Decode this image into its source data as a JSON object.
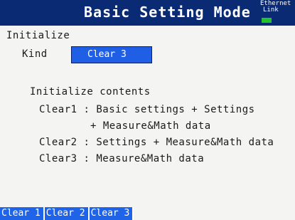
{
  "header": {
    "title": "Basic Setting Mode",
    "ethernet_line1": "Ethernet",
    "ethernet_line2": "Link",
    "link_led_color": "#22c22a",
    "background_color": "#0b2a74"
  },
  "section": {
    "heading": "Initialize",
    "kind_label": "Kind",
    "kind_value": "Clear 3"
  },
  "contents": {
    "heading": "Initialize contents",
    "lines": [
      "Clear1 : Basic settings + Settings",
      "+ Measure&Math data",
      "Clear2 : Settings + Measure&Math data",
      "Clear3 : Measure&Math data"
    ]
  },
  "softkeys": [
    "Clear 1",
    "Clear 2",
    "Clear 3"
  ],
  "colors": {
    "accent": "#1f5fe6",
    "softkey": "#1e63e8",
    "text": "#1a1a1a",
    "background": "#f4f4f2"
  }
}
